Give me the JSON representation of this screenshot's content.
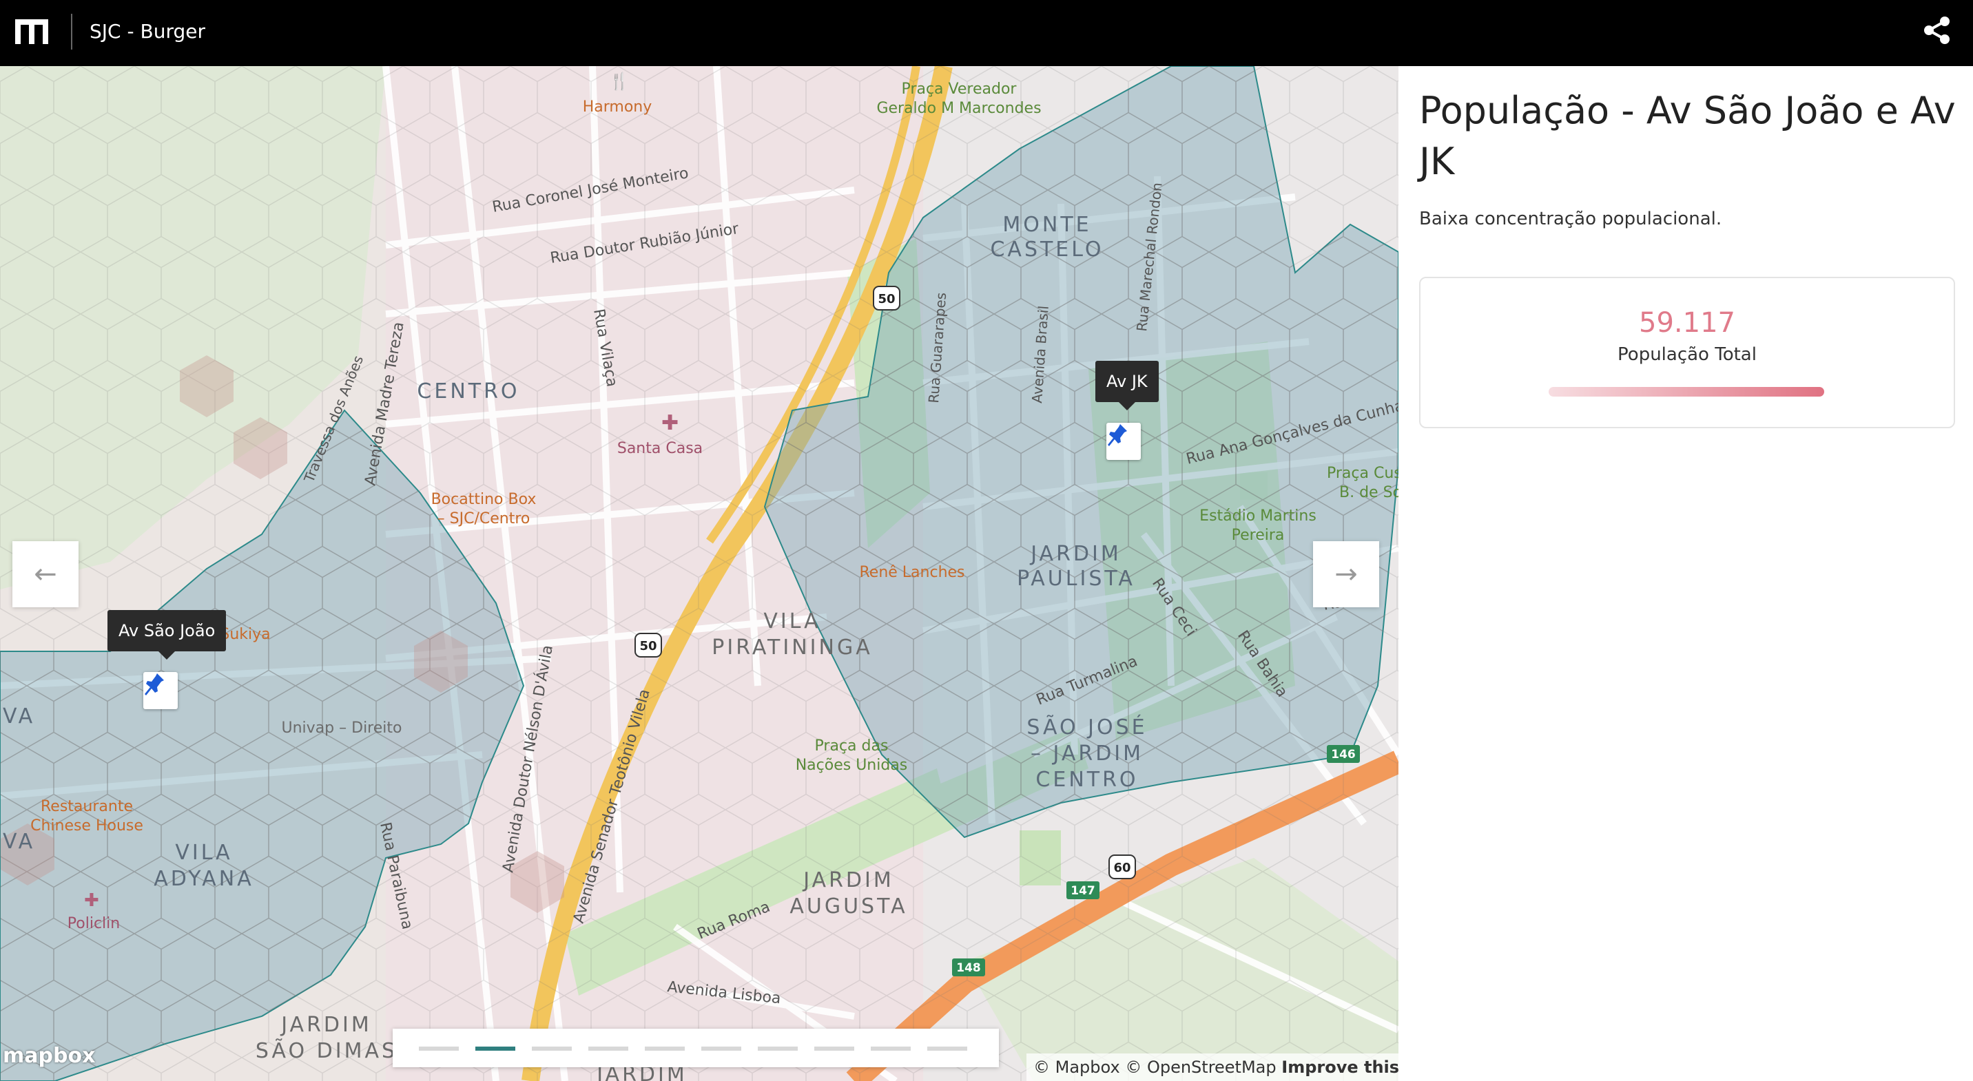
{
  "app": {
    "title": "SJC - Burger"
  },
  "colors": {
    "header_bg": "#000000",
    "accent": "#2f7f7f",
    "stat_value": "#e07a8a",
    "polygon_fill": "#7da9b9",
    "polygon_stroke": "#2d8a8a",
    "highway": "#f29a5b",
    "main_road": "#f2c55c",
    "park": "#cfe6c1"
  },
  "icons": {
    "logo": "mapbox-app-logo-icon",
    "share": "share-icon",
    "pin": "pushpin-icon",
    "prev": "arrow-left-icon",
    "next": "arrow-right-icon"
  },
  "panel": {
    "title": "População - Av São João e Av JK",
    "description": "Baixa concentração populacional.",
    "stat": {
      "value": "59.117",
      "label": "População Total",
      "level": 1.0
    }
  },
  "map": {
    "pins": [
      {
        "label": "Av São João"
      },
      {
        "label": "Av JK"
      }
    ],
    "labels": {
      "harmony": "Harmony",
      "praca_vereador_1": "Praça Vereador",
      "praca_vereador_2": "Geraldo M Marcondes",
      "rua_coronel": "Rua Coronel José Monteiro",
      "rua_rubiao": "Rua Doutor Rubião Júnior",
      "monte_1": "MONTE",
      "monte_2": "CASTELO",
      "centro": "CENTRO",
      "rua_vilaca": "Rua Vilaça",
      "santa_casa": "Santa Casa",
      "travessa": "Travessa dos Anões",
      "madre_tereza": "Avenida Madre Tereza",
      "bocattino_1": "Bocattino Box",
      "bocattino_2": "– SJC/Centro",
      "rua_guararapes": "Rua Guararapes",
      "avenida_brasil": "Avenida Brasil",
      "marechal": "Rua Marechal Rondon",
      "ana_goncalves": "Rua Ana Gonçalves da Cunha",
      "praca_cus_1": "Praça Cus",
      "praca_cus_2": "B. de Sou",
      "estadio_1": "Estádio Martins",
      "estadio_2": "Pereira",
      "rene": "Renê Lanches",
      "jardim_paulista_1": "JARDIM",
      "jardim_paulista_2": "PAULISTA",
      "rua_ceci": "Rua Ceci",
      "rua_bahia": "Rua Bahia",
      "rua_cut": "Rua",
      "sukiya": "Sukiya",
      "vila_pir_1": "VILA",
      "vila_pir_2": "PIRATININGA",
      "va_1": "VA",
      "univap": "Univap – Direito",
      "nelson": "Avenida Doutor Nélson D'Ávila",
      "teotonio": "Avenida Senador Teotônio Vilela",
      "rua_turmalina": "Rua Turmalina",
      "sao_jose_1": "SÃO JOSÉ",
      "sao_jose_2": "– JARDIM",
      "sao_jose_3": "CENTRO",
      "praca_nacoes_1": "Praça das",
      "praca_nacoes_2": "Nações Unidas",
      "restaurante_1": "Restaurante",
      "restaurante_2": "Chinese House",
      "va_2": "VA",
      "rua_paraibuna": "Rua Paraibuna",
      "vila_adyana_1": "VILA",
      "vila_adyana_2": "ADYANA",
      "policlin": "Policlin",
      "jardim_augusta_1": "JARDIM",
      "jardim_augusta_2": "AUGUSTA",
      "rua_roma": "Rua Roma",
      "avenida_lisboa": "Avenida Lisboa",
      "jardim_sao_dimas_1": "JARDIM",
      "jardim_sao_dimas_2": "SÃO DIMAS",
      "jardim_bottom": "JARDIM"
    },
    "shields": {
      "s50a": "50",
      "s50b": "50",
      "s60": "60",
      "s146": "146",
      "s147": "147",
      "s148": "148"
    },
    "attribution": {
      "mapbox": "© Mapbox",
      "osm": "© OpenStreetMap",
      "improve": "Improve this map"
    },
    "mapbox_logo": "mapbox",
    "pager": {
      "count": 10,
      "active": 1
    }
  }
}
